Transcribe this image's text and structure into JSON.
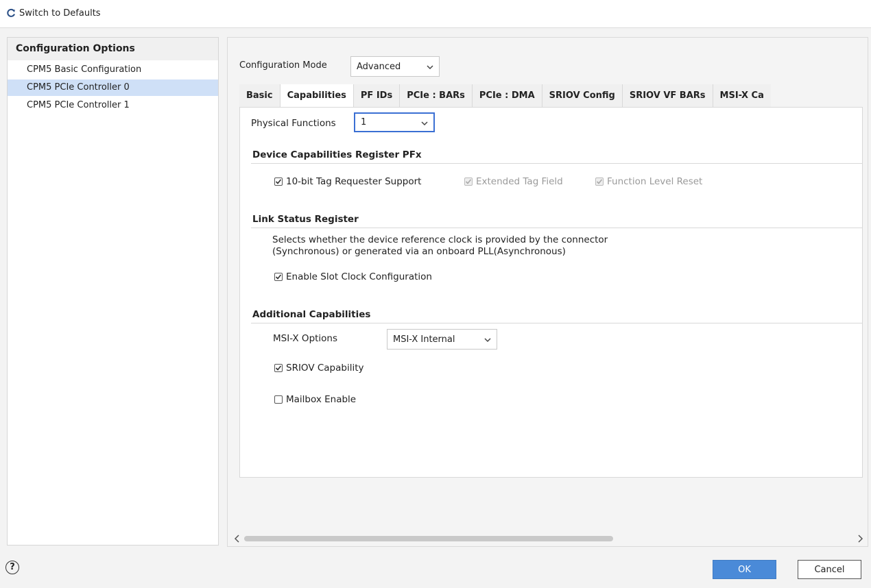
{
  "toolbar": {
    "switch_defaults": "Switch to Defaults"
  },
  "left_panel": {
    "title": "Configuration Options",
    "items": [
      {
        "label": "CPM5 Basic Configuration",
        "selected": false
      },
      {
        "label": "CPM5 PCIe Controller 0",
        "selected": true
      },
      {
        "label": "CPM5 PCIe Controller 1",
        "selected": false
      }
    ]
  },
  "config_mode": {
    "label": "Configuration Mode",
    "value": "Advanced"
  },
  "tabs": [
    {
      "label": "Basic",
      "active": false
    },
    {
      "label": "Capabilities",
      "active": true
    },
    {
      "label": "PF IDs",
      "active": false
    },
    {
      "label": "PCIe : BARs",
      "active": false
    },
    {
      "label": "PCIe : DMA",
      "active": false
    },
    {
      "label": "SRIOV Config",
      "active": false
    },
    {
      "label": "SRIOV VF BARs",
      "active": false
    },
    {
      "label": "MSI-X Ca",
      "active": false
    }
  ],
  "capabilities": {
    "physical_functions_label": "Physical Functions",
    "physical_functions_value": "1",
    "device_caps": {
      "title": "Device Capabilities Register PFx",
      "tag_requester": {
        "label": "10-bit Tag Requester Support",
        "checked": true,
        "disabled": false
      },
      "extended_tag": {
        "label": "Extended Tag Field",
        "checked": true,
        "disabled": true
      },
      "function_reset": {
        "label": "Function Level Reset",
        "checked": true,
        "disabled": true
      }
    },
    "link_status": {
      "title": "Link Status Register",
      "desc_line1": "Selects whether the device reference clock is provided by the connector",
      "desc_line2": "(Synchronous) or generated via an onboard PLL(Asynchronous)",
      "slot_clock": {
        "label": "Enable Slot Clock Configuration",
        "checked": true
      }
    },
    "additional": {
      "title": "Additional Capabilities",
      "msix_label": "MSI-X Options",
      "msix_value": "MSI-X Internal",
      "sriov": {
        "label": "SRIOV Capability",
        "checked": true
      },
      "mailbox": {
        "label": "Mailbox Enable",
        "checked": false
      }
    }
  },
  "footer": {
    "help": "?",
    "ok": "OK",
    "cancel": "Cancel"
  },
  "colors": {
    "accent": "#4a8ad8",
    "selection": "#cfe0f7",
    "focus_border": "#3a6fd3"
  }
}
